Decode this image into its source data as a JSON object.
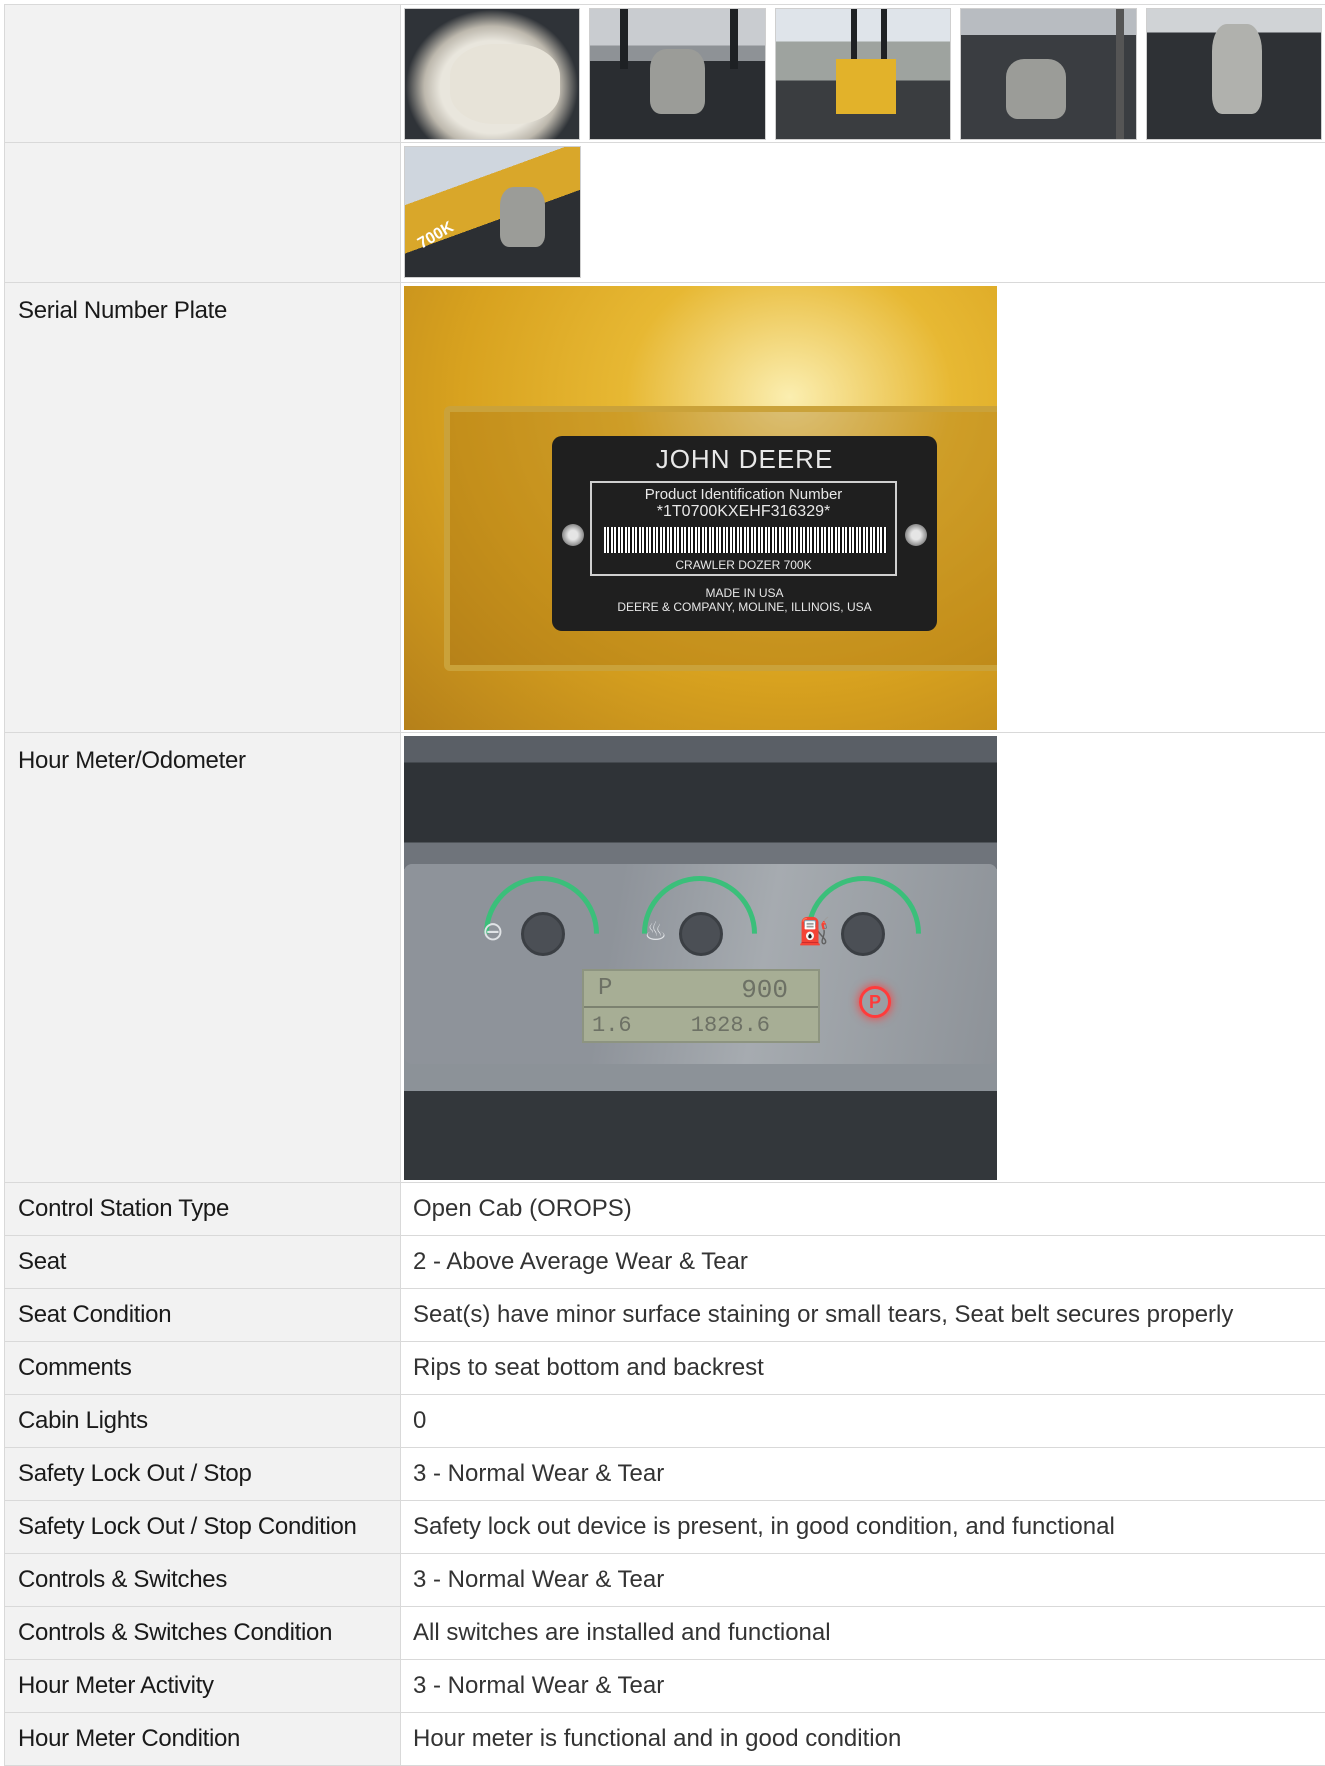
{
  "rows": [
    {
      "label": "Control Station Type",
      "value": "Open Cab (OROPS)"
    },
    {
      "label": "Seat",
      "value": "2 - Above Average Wear & Tear"
    },
    {
      "label": "Seat Condition",
      "value": "Seat(s) have minor surface staining or small tears, Seat belt secures properly"
    },
    {
      "label": "Comments",
      "value": "Rips to seat bottom and backrest"
    },
    {
      "label": "Cabin Lights",
      "value": "0"
    },
    {
      "label": "Safety Lock Out / Stop",
      "value": "3 - Normal Wear & Tear"
    },
    {
      "label": "Safety Lock Out / Stop Condition",
      "value": "Safety lock out device is present, in good condition, and functional"
    },
    {
      "label": "Controls & Switches",
      "value": "3 - Normal Wear & Tear"
    },
    {
      "label": "Controls & Switches Condition",
      "value": "All switches are installed and functional"
    },
    {
      "label": "Hour Meter Activity",
      "value": "3 - Normal Wear & Tear"
    },
    {
      "label": "Hour Meter Condition",
      "value": "Hour meter is functional and in good condition"
    }
  ],
  "photo_rows": {
    "serial_label": "Serial Number Plate",
    "hour_label": "Hour Meter/Odometer"
  },
  "plate": {
    "brand": "JOHN DEERE",
    "pin_title": "Product Identification Number",
    "pin": "*1T0700KXEHF316329*",
    "model": "CRAWLER DOZER 700K",
    "made": "MADE IN USA",
    "company": "DEERE & COMPANY, MOLINE, ILLINOIS, USA"
  },
  "dash": {
    "rpm": "900",
    "hours": "1828.6",
    "gear": "P",
    "speed": "1.6",
    "park": "P"
  },
  "thumb_badge": "700K",
  "colors": {
    "label_bg": "#f2f2f2",
    "border": "#d9d9d9",
    "deere_yellow": "#e2b22a"
  }
}
